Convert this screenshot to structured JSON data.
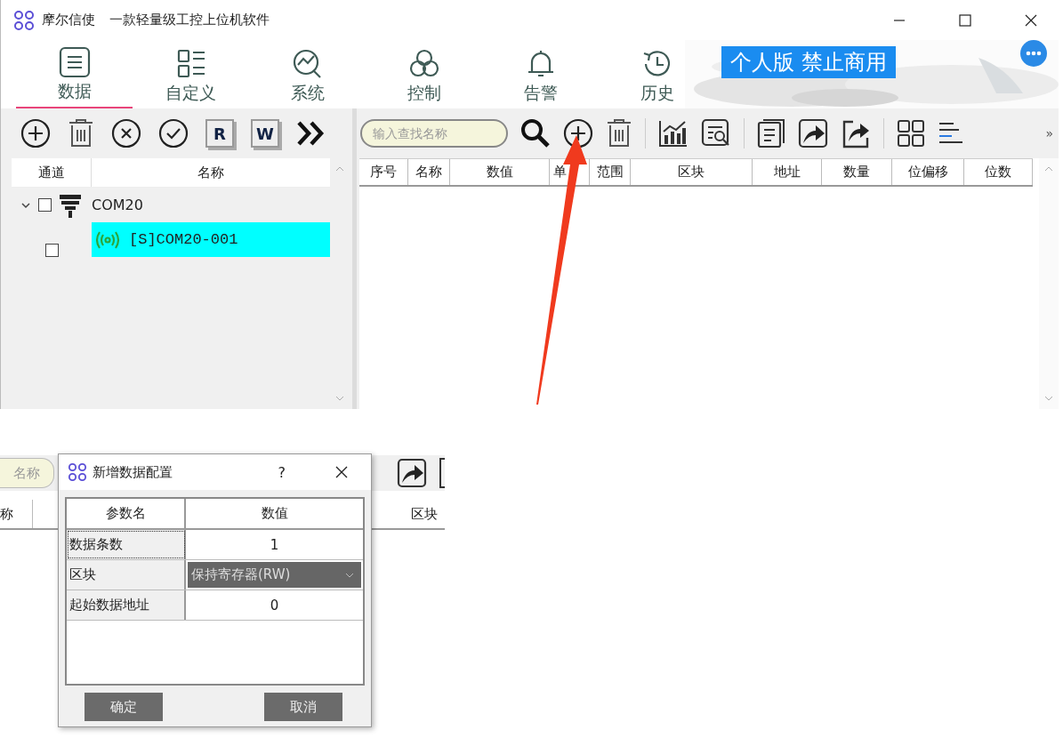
{
  "window": {
    "title": "摩尔信使",
    "subtitle": "一款轻量级工控上位机软件"
  },
  "nav_tabs": [
    {
      "label": "数据",
      "selected": true
    },
    {
      "label": "自定义",
      "selected": false
    },
    {
      "label": "系统",
      "selected": false
    },
    {
      "label": "控制",
      "selected": false
    },
    {
      "label": "告警",
      "selected": false
    },
    {
      "label": "历史",
      "selected": false
    }
  ],
  "banner": "个人版  禁止商用",
  "left_toolbar": {
    "read_label": "R",
    "write_label": "W"
  },
  "tree": {
    "columns": [
      "通道",
      "名称"
    ],
    "nodes": [
      {
        "label": "COM20",
        "kind": "port",
        "expanded": true,
        "checked": false,
        "selected": false,
        "children": [
          {
            "label": "[S]COM20-001",
            "kind": "slave",
            "checked": false,
            "selected": true
          }
        ]
      }
    ]
  },
  "search": {
    "placeholder": "输入查找名称"
  },
  "right_toolbar": {
    "overflow": "»"
  },
  "table": {
    "columns": [
      "序号",
      "名称",
      "数值",
      "单",
      "范围",
      "区块",
      "地址",
      "数量",
      "位偏移",
      "位数"
    ]
  },
  "snippet": {
    "search_fragment": "名称",
    "columns": [
      "称",
      "区块"
    ]
  },
  "dialog": {
    "title": "新增数据配置",
    "help": "?",
    "columns": [
      "参数名",
      "数值"
    ],
    "rows": [
      {
        "name": "数据条数",
        "value": "1",
        "kind": "text",
        "focused": true
      },
      {
        "name": "区块",
        "value": "保持寄存器(RW)",
        "kind": "select",
        "focused": false
      },
      {
        "name": "起始数据地址",
        "value": "0",
        "kind": "text",
        "focused": false
      }
    ],
    "buttons": [
      "确定",
      "取消"
    ]
  }
}
